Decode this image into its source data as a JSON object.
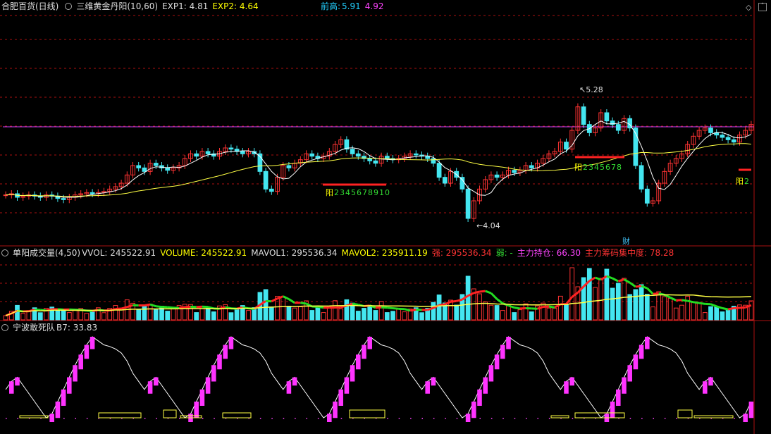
{
  "main_panel": {
    "security": "合肥百货(日线)",
    "indicator": "三维黄金丹阳(10,60)",
    "exp1_label": "EXP1: 4.81",
    "exp2_label": "EXP2: 4.64",
    "prev_high_label": "前高:",
    "prev_high_v1": "5.91",
    "prev_high_v2": "4.92",
    "max_price": "5.28",
    "min_price": "4.04",
    "yang1": "阳",
    "yang1_seq": "2345678910",
    "yang2": "阳",
    "yang2_seq": "2345678",
    "yang3": "阳",
    "yang3_seq": "2",
    "cai_badge": "财"
  },
  "volume_panel": {
    "indicator": "单阳成交量(4,50)",
    "vvol": "VVOL: 245522.91",
    "volume": "VOLUME: 245522.91",
    "mavol1": "MAVOL1: 295536.34",
    "mavol2": "MAVOL2: 235911.19",
    "strong": "强: 295536.34",
    "weak": "弱: -",
    "holding": "主力持仓: 66.30",
    "concentration": "主力筹码集中度: 78.28"
  },
  "osc_panel": {
    "indicator": "宁波敢死队",
    "b7": "B7: 33.83"
  },
  "colors": {
    "up": "#ff3333",
    "down": "#44e6f0",
    "ma_short": "#ffffff",
    "ma_long": "#ffff44",
    "ref_line": "#cc44ff",
    "osc": "#ff33ff"
  },
  "chart_data": {
    "type": "candlestick",
    "price_range": [
      4.04,
      5.28
    ],
    "reference_high": 4.92,
    "closes": [
      4.35,
      4.36,
      4.33,
      4.34,
      4.35,
      4.34,
      4.33,
      4.35,
      4.34,
      4.32,
      4.31,
      4.33,
      4.35,
      4.36,
      4.37,
      4.36,
      4.37,
      4.38,
      4.4,
      4.42,
      4.45,
      4.52,
      4.6,
      4.58,
      4.55,
      4.62,
      4.6,
      4.58,
      4.56,
      4.58,
      4.6,
      4.66,
      4.7,
      4.68,
      4.72,
      4.7,
      4.68,
      4.72,
      4.75,
      4.74,
      4.72,
      4.7,
      4.72,
      4.7,
      4.55,
      4.4,
      4.38,
      4.5,
      4.6,
      4.58,
      4.62,
      4.65,
      4.7,
      4.68,
      4.66,
      4.68,
      4.72,
      4.78,
      4.82,
      4.74,
      4.7,
      4.68,
      4.66,
      4.64,
      4.62,
      4.68,
      4.66,
      4.65,
      4.66,
      4.68,
      4.7,
      4.69,
      4.68,
      4.66,
      4.62,
      4.5,
      4.45,
      4.55,
      4.5,
      4.4,
      4.15,
      4.3,
      4.4,
      4.48,
      4.52,
      4.5,
      4.52,
      4.56,
      4.54,
      4.56,
      4.6,
      4.58,
      4.62,
      4.66,
      4.7,
      4.72,
      4.8,
      4.74,
      4.9,
      5.1,
      4.95,
      4.88,
      4.92,
      5.05,
      4.98,
      4.95,
      4.9,
      5.0,
      4.92,
      4.6,
      4.4,
      4.28,
      4.3,
      4.45,
      4.55,
      4.62,
      4.66,
      4.7,
      4.78,
      4.85,
      4.9,
      4.92,
      4.88,
      4.86,
      4.84,
      4.82,
      4.8,
      4.86,
      4.9,
      4.95
    ]
  }
}
